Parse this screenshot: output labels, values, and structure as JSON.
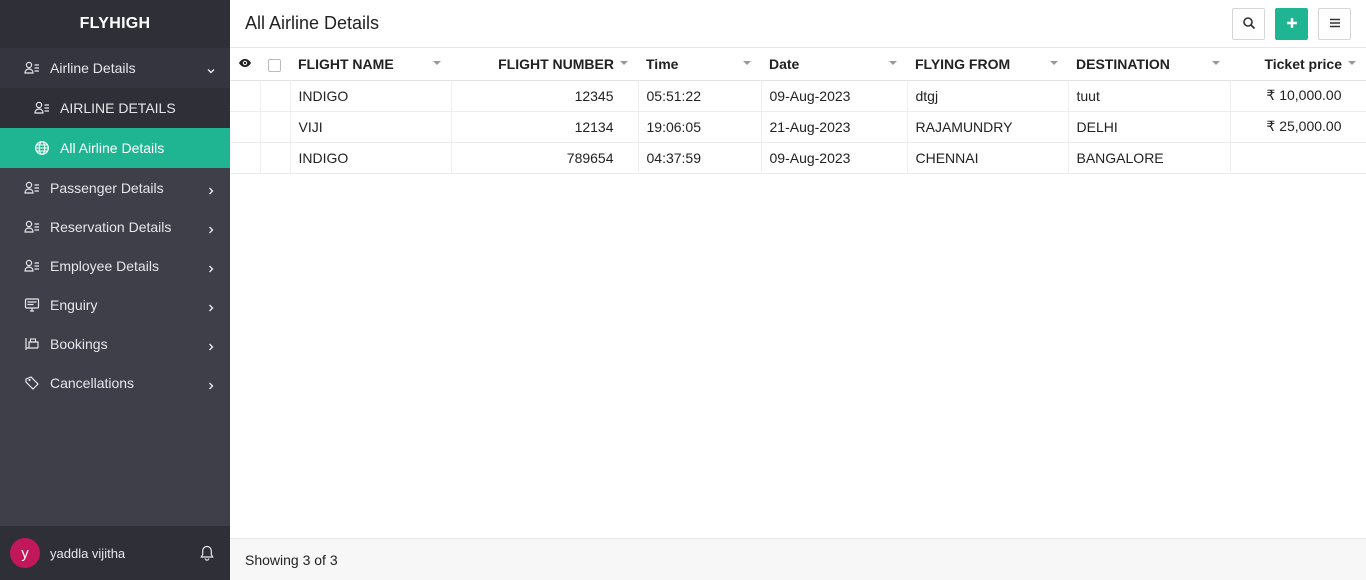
{
  "app": {
    "brand": "FLYHIGH"
  },
  "sidebar": {
    "items": [
      {
        "label": "Airline Details",
        "icon": "user-list-icon",
        "expanded": true
      },
      {
        "label": "Passenger Details",
        "icon": "user-list-icon"
      },
      {
        "label": "Reservation Details",
        "icon": "user-list-icon"
      },
      {
        "label": "Employee Details",
        "icon": "user-list-icon"
      },
      {
        "label": "Enguiry",
        "icon": "monitor-icon"
      },
      {
        "label": "Bookings",
        "icon": "desk-icon"
      },
      {
        "label": "Cancellations",
        "icon": "tag-icon"
      }
    ],
    "subitems": [
      {
        "label": "AIRLINE DETAILS",
        "icon": "user-list-icon"
      },
      {
        "label": "All Airline Details",
        "icon": "globe-icon",
        "active": true
      }
    ],
    "user": {
      "initial": "y",
      "name": "yaddla vijitha"
    }
  },
  "header": {
    "title": "All Airline Details"
  },
  "table": {
    "columns": [
      "FLIGHT NAME",
      "FLIGHT NUMBER",
      "Time",
      "Date",
      "FLYING FROM",
      "DESTINATION",
      "Ticket price"
    ],
    "rows": [
      [
        "INDIGO",
        "12345",
        "05:51:22",
        "09-Aug-2023",
        "dtgj",
        "tuut",
        "₹ 10,000.00"
      ],
      [
        "VIJI",
        "12134",
        "19:06:05",
        "21-Aug-2023",
        "RAJAMUNDRY",
        "DELHI",
        "₹ 25,000.00"
      ],
      [
        "INDIGO",
        "789654",
        "04:37:59",
        "09-Aug-2023",
        "CHENNAI",
        "BANGALORE",
        ""
      ]
    ]
  },
  "footer": {
    "status": "Showing 3 of 3"
  },
  "colors": {
    "accent": "#1fb592",
    "sidebar": "#3f3f4a",
    "sidebar_dark": "#2f2f38",
    "avatar": "#c2185b"
  }
}
